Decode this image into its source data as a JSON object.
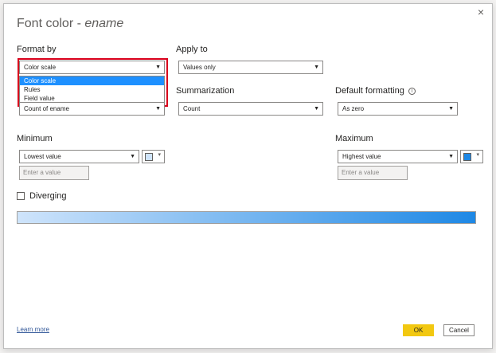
{
  "dialog": {
    "title_prefix": "Font color - ",
    "title_field": "ename",
    "close_glyph": "×"
  },
  "format_by": {
    "label": "Format by",
    "selected": "Color scale",
    "options": [
      "Color scale",
      "Rules",
      "Field value"
    ],
    "highlighted_option": "Color scale"
  },
  "based_on": {
    "value": "Count of ename"
  },
  "apply_to": {
    "label": "Apply to",
    "value": "Values only"
  },
  "summarization": {
    "label": "Summarization",
    "value": "Count"
  },
  "default_formatting": {
    "label": "Default formatting",
    "info_glyph": "i",
    "value": "As zero"
  },
  "minimum": {
    "label": "Minimum",
    "value": "Lowest value",
    "placeholder": "Enter a value",
    "color": "#cfe4fb"
  },
  "maximum": {
    "label": "Maximum",
    "value": "Highest value",
    "placeholder": "Enter a value",
    "color": "#1e88e5"
  },
  "diverging": {
    "label": "Diverging",
    "checked": false
  },
  "gradient": {
    "from": "#cfe4fb",
    "to": "#1e88e5"
  },
  "footer": {
    "learn_more": "Learn more",
    "ok": "OK",
    "cancel": "Cancel"
  },
  "icons": {
    "dropdown_arrow": "▼",
    "swatch_arrow": "▾"
  }
}
